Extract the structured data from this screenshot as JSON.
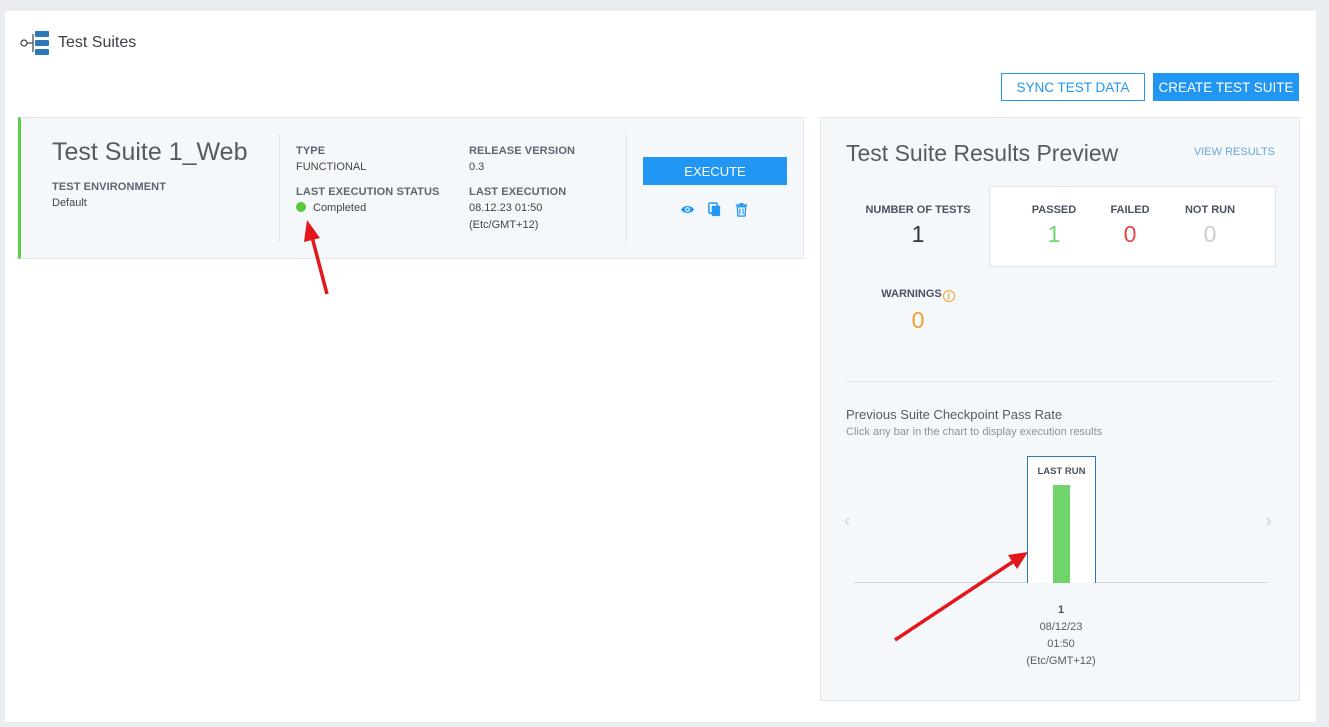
{
  "header": {
    "title": "Test Suites",
    "icon": "hierarchy-icon"
  },
  "toolbar": {
    "sync_label": "SYNC TEST DATA",
    "create_label": "CREATE TEST SUITE"
  },
  "suite": {
    "name": "Test Suite 1_Web",
    "env_label": "TEST ENVIRONMENT",
    "env_value": "Default",
    "type_label": "TYPE",
    "type_value": "FUNCTIONAL",
    "release_label": "RELEASE VERSION",
    "release_value": "0.3",
    "status_label": "LAST EXECUTION STATUS",
    "status_value": "Completed",
    "status_color": "#59c83a",
    "last_exec_label": "LAST EXECUTION",
    "last_exec_date": "08.12.23 01:50",
    "last_exec_tz": "(Etc/GMT+12)",
    "execute_label": "EXECUTE",
    "accent_color": "#5ccf4a"
  },
  "preview": {
    "title": "Test Suite Results Preview",
    "view_results": "VIEW RESULTS",
    "tests_label": "NUMBER OF TESTS",
    "tests_value": "1",
    "passed_label": "PASSED",
    "passed_value": "1",
    "failed_label": "FAILED",
    "failed_value": "0",
    "notrun_label": "NOT RUN",
    "notrun_value": "0",
    "warnings_label": "WARNINGS",
    "warnings_value": "0",
    "chart_title": "Previous Suite Checkpoint Pass Rate",
    "chart_sub": "Click any bar in the chart to display execution results",
    "colors": {
      "passed": "#6fd46b",
      "failed": "#e84545",
      "notrun": "#c8cdd3",
      "warnings": "#f0a030"
    }
  },
  "chart_data": {
    "type": "bar",
    "categories": [
      "1"
    ],
    "values": [
      100
    ],
    "bar_label": "LAST RUN",
    "x_date": "08/12/23",
    "x_time": "01:50",
    "x_tz": "(Etc/GMT+12)"
  }
}
